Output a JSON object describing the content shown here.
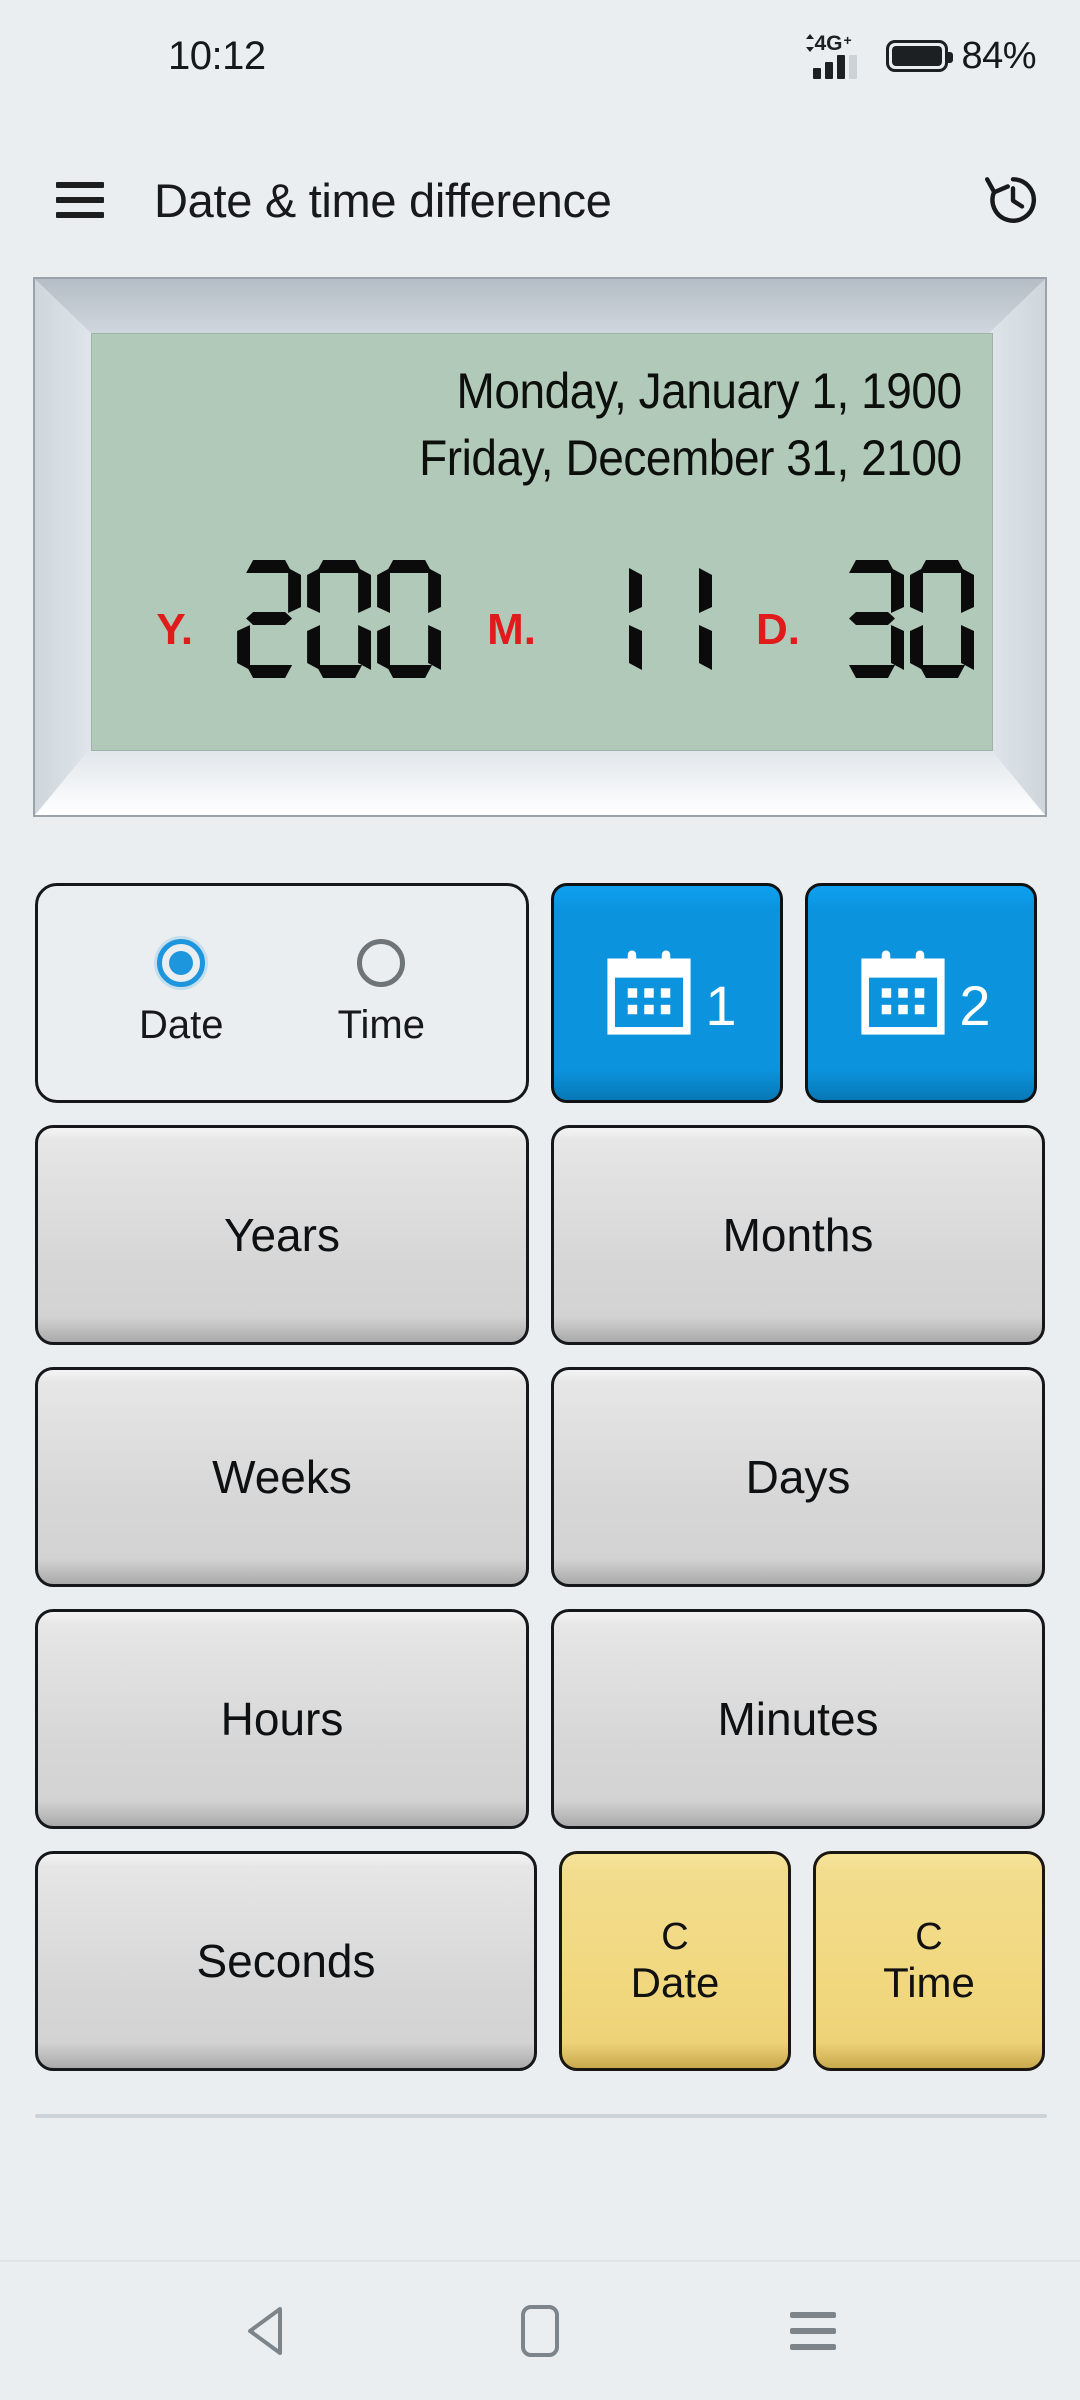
{
  "status_bar": {
    "time": "10:12",
    "network_label": "4G",
    "network_sup": "+",
    "battery_percent": "84%",
    "signal_icon": "signal-bars-icon",
    "battery_icon": "battery-icon"
  },
  "header": {
    "menu_icon": "hamburger-menu-icon",
    "title": "Date & time difference",
    "history_icon": "history-icon"
  },
  "display": {
    "date_1": "Monday, January 1, 1900",
    "date_2": "Friday, December 31, 2100",
    "lcd_background": "#b1c9b9",
    "unit_color": "#e01b1b",
    "segments": [
      {
        "unit": "Y.",
        "value": "200"
      },
      {
        "unit": "M.",
        "value": "11"
      },
      {
        "unit": "D.",
        "value": "30"
      }
    ]
  },
  "mode_selector": {
    "options": [
      {
        "label": "Date",
        "selected": true
      },
      {
        "label": "Time",
        "selected": false
      }
    ],
    "accent_color": "#1e96dd"
  },
  "calendar_buttons": [
    {
      "icon": "calendar-icon",
      "number": "1"
    },
    {
      "icon": "calendar-icon",
      "number": "2"
    }
  ],
  "unit_buttons": [
    "Years",
    "Months",
    "Weeks",
    "Days",
    "Hours",
    "Minutes",
    "Seconds"
  ],
  "clear_buttons": [
    {
      "line1": "C",
      "line2": "Date"
    },
    {
      "line1": "C",
      "line2": "Time"
    }
  ],
  "nav_bar": {
    "back": "back-icon",
    "home": "home-icon",
    "recents": "recents-icon"
  }
}
